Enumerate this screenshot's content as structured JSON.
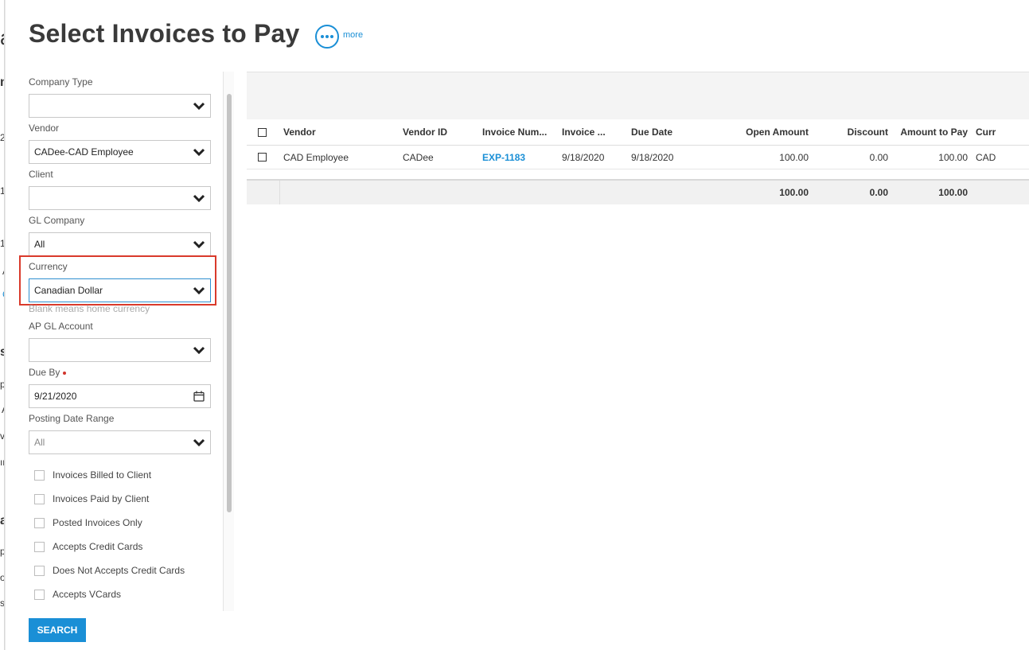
{
  "page": {
    "title": "Select Invoices to Pay",
    "more_label": "more"
  },
  "left_strip": [
    "a",
    "n",
    "2",
    "1",
    "1",
    "A",
    "C",
    "s",
    "p",
    "A",
    "v",
    "ır",
    "a",
    "p",
    "o",
    "s"
  ],
  "filters": {
    "company_type": {
      "label": "Company Type",
      "value": ""
    },
    "vendor": {
      "label": "Vendor",
      "value": "CADee-CAD Employee"
    },
    "client": {
      "label": "Client",
      "value": ""
    },
    "gl_company": {
      "label": "GL Company",
      "value": "All"
    },
    "currency": {
      "label": "Currency",
      "value": "Canadian Dollar",
      "hint": "Blank means home currency"
    },
    "ap_gl_account": {
      "label": "AP GL Account",
      "value": ""
    },
    "due_by": {
      "label": "Due By",
      "value": "9/21/2020",
      "required": true
    },
    "posting_date_range": {
      "label": "Posting Date Range",
      "value": "All"
    }
  },
  "checkboxes": [
    {
      "label": "Invoices Billed to Client",
      "checked": false
    },
    {
      "label": "Invoices Paid by Client",
      "checked": false
    },
    {
      "label": "Posted Invoices Only",
      "checked": false
    },
    {
      "label": "Accepts Credit Cards",
      "checked": false
    },
    {
      "label": "Does Not Accepts Credit Cards",
      "checked": false
    },
    {
      "label": "Accepts VCards",
      "checked": false
    }
  ],
  "search_button": "SEARCH",
  "grid": {
    "columns": [
      "Vendor",
      "Vendor ID",
      "Invoice Num...",
      "Invoice ...",
      "Due Date",
      "Open Amount",
      "Discount",
      "Amount to Pay",
      "Curr"
    ],
    "rows": [
      {
        "vendor": "CAD Employee",
        "vendor_id": "CADee",
        "invoice_num": "EXP-1183",
        "invoice_date": "9/18/2020",
        "due_date": "9/18/2020",
        "open_amount": "100.00",
        "discount": "0.00",
        "amount_to_pay": "100.00",
        "currency": "CAD"
      }
    ],
    "totals": {
      "open_amount": "100.00",
      "discount": "0.00",
      "amount_to_pay": "100.00"
    }
  },
  "colors": {
    "accent": "#1a8fd6",
    "highlight": "#d93a2b"
  }
}
